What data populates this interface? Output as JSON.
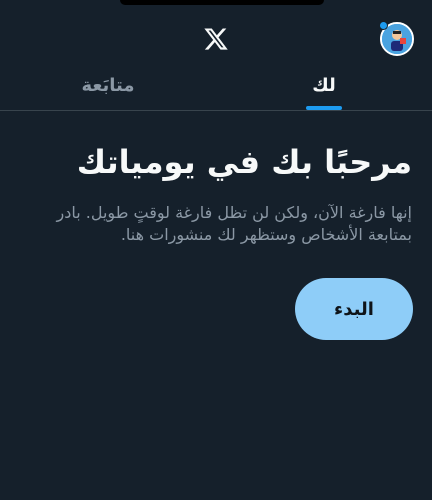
{
  "app": {
    "logo_icon": "x-logo-icon",
    "avatar_icon": "profile-avatar-icon"
  },
  "tabs": [
    {
      "label": "لك",
      "active": true
    },
    {
      "label": "متابَعة",
      "active": false
    }
  ],
  "empty_state": {
    "title": "مرحبًا بك في يومياتك",
    "subtitle": "إنها فارغة الآن، ولكن لن تظل فارغة لوقتٍ طويل. بادر بمتابعة الأشخاص وستظهر لك منشورات هنا.",
    "button_label": "البدء"
  },
  "colors": {
    "background": "#15202b",
    "accent": "#1d9bf0",
    "button": "#8ecdf8",
    "muted_text": "#8b98a5"
  }
}
